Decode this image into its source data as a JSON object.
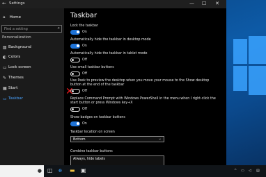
{
  "window": {
    "title": "Settings",
    "back_icon": "arrow-left-icon",
    "min_glyph": "—",
    "max_glyph": "☐",
    "close_glyph": "✕"
  },
  "sidebar": {
    "home": "Home",
    "search_placeholder": "Find a setting",
    "section": "Personalization",
    "items": [
      {
        "label": "Background",
        "icon": "picture-icon",
        "glyph": "▨"
      },
      {
        "label": "Colors",
        "icon": "palette-icon",
        "glyph": "◐"
      },
      {
        "label": "Lock screen",
        "icon": "lock-screen-icon",
        "glyph": "▭"
      },
      {
        "label": "Themes",
        "icon": "brush-icon",
        "glyph": "✎"
      },
      {
        "label": "Start",
        "icon": "start-icon",
        "glyph": "▦"
      },
      {
        "label": "Taskbar",
        "icon": "taskbar-icon",
        "glyph": "▭",
        "active": true
      }
    ]
  },
  "content": {
    "heading": "Taskbar",
    "settings": [
      {
        "label": "Lock the taskbar",
        "state": "On"
      },
      {
        "label": "Automatically hide the taskbar in desktop mode",
        "state": "On"
      },
      {
        "label": "Automatically hide the taskbar in tablet mode",
        "state": "Off"
      },
      {
        "label": "Use small taskbar buttons",
        "state": "Off"
      },
      {
        "label": "Use Peek to preview the desktop when you move your mouse to the Show desktop button at the end of the taskbar",
        "state": "Off"
      },
      {
        "label": "Replace Command Prompt with Windows PowerShell in the menu when I right-click the start button or press Windows key+X",
        "state": "Off"
      },
      {
        "label": "Show badges on taskbar buttons",
        "state": "On"
      }
    ],
    "location_label": "Taskbar location on screen",
    "location_value": "Bottom",
    "combine_label": "Combine taskbar buttons",
    "combine_value": "Always, hide labels"
  },
  "colors": {
    "accent": "#1e73d8",
    "active_nav": "#4aa3ff",
    "annotation_x": "#e0181b"
  }
}
